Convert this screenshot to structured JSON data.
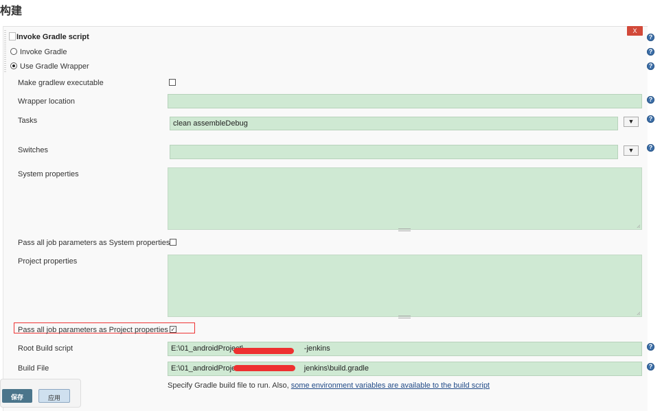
{
  "page": {
    "heading": "构建"
  },
  "step": {
    "title": "Invoke Gradle script",
    "delete_label": "X",
    "radio_invoke_gradle": "Invoke Gradle",
    "radio_use_wrapper": "Use Gradle Wrapper",
    "make_executable_label": "Make gradlew executable",
    "wrapper_location_label": "Wrapper location",
    "wrapper_location_value": "",
    "tasks_label": "Tasks",
    "tasks_value": "clean assembleDebug",
    "switches_label": "Switches",
    "switches_value": "",
    "system_properties_label": "System properties",
    "pass_system_label": "Pass all job parameters as System properties",
    "project_properties_label": "Project properties",
    "pass_project_label": "Pass all job parameters as Project properties",
    "pass_project_checked": "✓",
    "root_build_script_label": "Root Build script",
    "root_build_script_prefix": "E:\\01_androidProject\\",
    "root_build_script_suffix": "-jenkins",
    "build_file_label": "Build File",
    "build_file_prefix": "E:\\01_androidProject\\",
    "build_file_suffix": "jenkins\\build.gradle",
    "build_file_hint": "Specify Gradle build file to run. Also,",
    "build_file_hint_link": "some environment variables are available to the build script",
    "dropdown_arrow": "▼",
    "help_glyph": "?"
  },
  "footer": {
    "save_label": "保存",
    "apply_label": "应用"
  },
  "colors": {
    "field_bg": "#cfe9d3",
    "delete_bg": "#d24939",
    "help_bg": "#3b6ea8",
    "save_bg": "#4b758b"
  }
}
